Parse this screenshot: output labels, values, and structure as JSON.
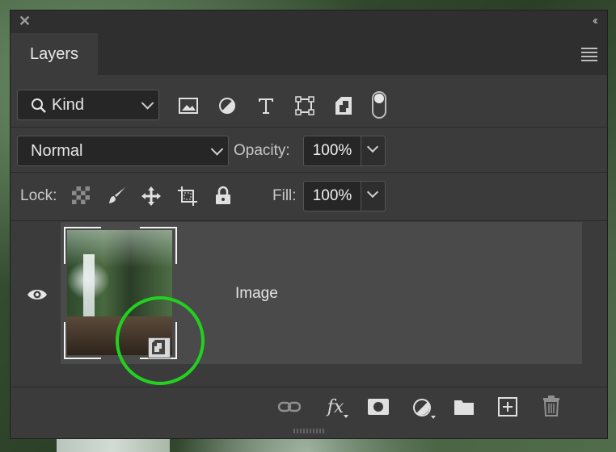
{
  "panel": {
    "tab_title": "Layers"
  },
  "filter_row": {
    "kind_label": "Kind",
    "filter_icons": [
      "image-filter-icon",
      "adjustment-filter-icon",
      "type-filter-icon",
      "shape-filter-icon",
      "smart-object-filter-icon"
    ],
    "filter_toggle": "on"
  },
  "blend_row": {
    "blend_mode": "Normal",
    "opacity_label": "Opacity:",
    "opacity_value": "100%"
  },
  "lock_row": {
    "lock_label": "Lock:",
    "lock_icons": [
      "lock-transparent-pixels-icon",
      "lock-image-pixels-icon",
      "lock-position-icon",
      "lock-artboard-icon",
      "lock-all-icon"
    ],
    "fill_label": "Fill:",
    "fill_value": "100%"
  },
  "layers": [
    {
      "name": "Image",
      "visible": true,
      "type": "smart-object"
    }
  ],
  "footer_icons": [
    "link-layers-icon",
    "fx-icon",
    "add-mask-icon",
    "new-fill-adjustment-icon",
    "new-group-icon",
    "new-layer-icon",
    "delete-layer-icon"
  ],
  "colors": {
    "panel_bg": "#3b3b3b",
    "selected_layer_bg": "#4a4a4a",
    "highlight_circle": "#22d11f"
  }
}
